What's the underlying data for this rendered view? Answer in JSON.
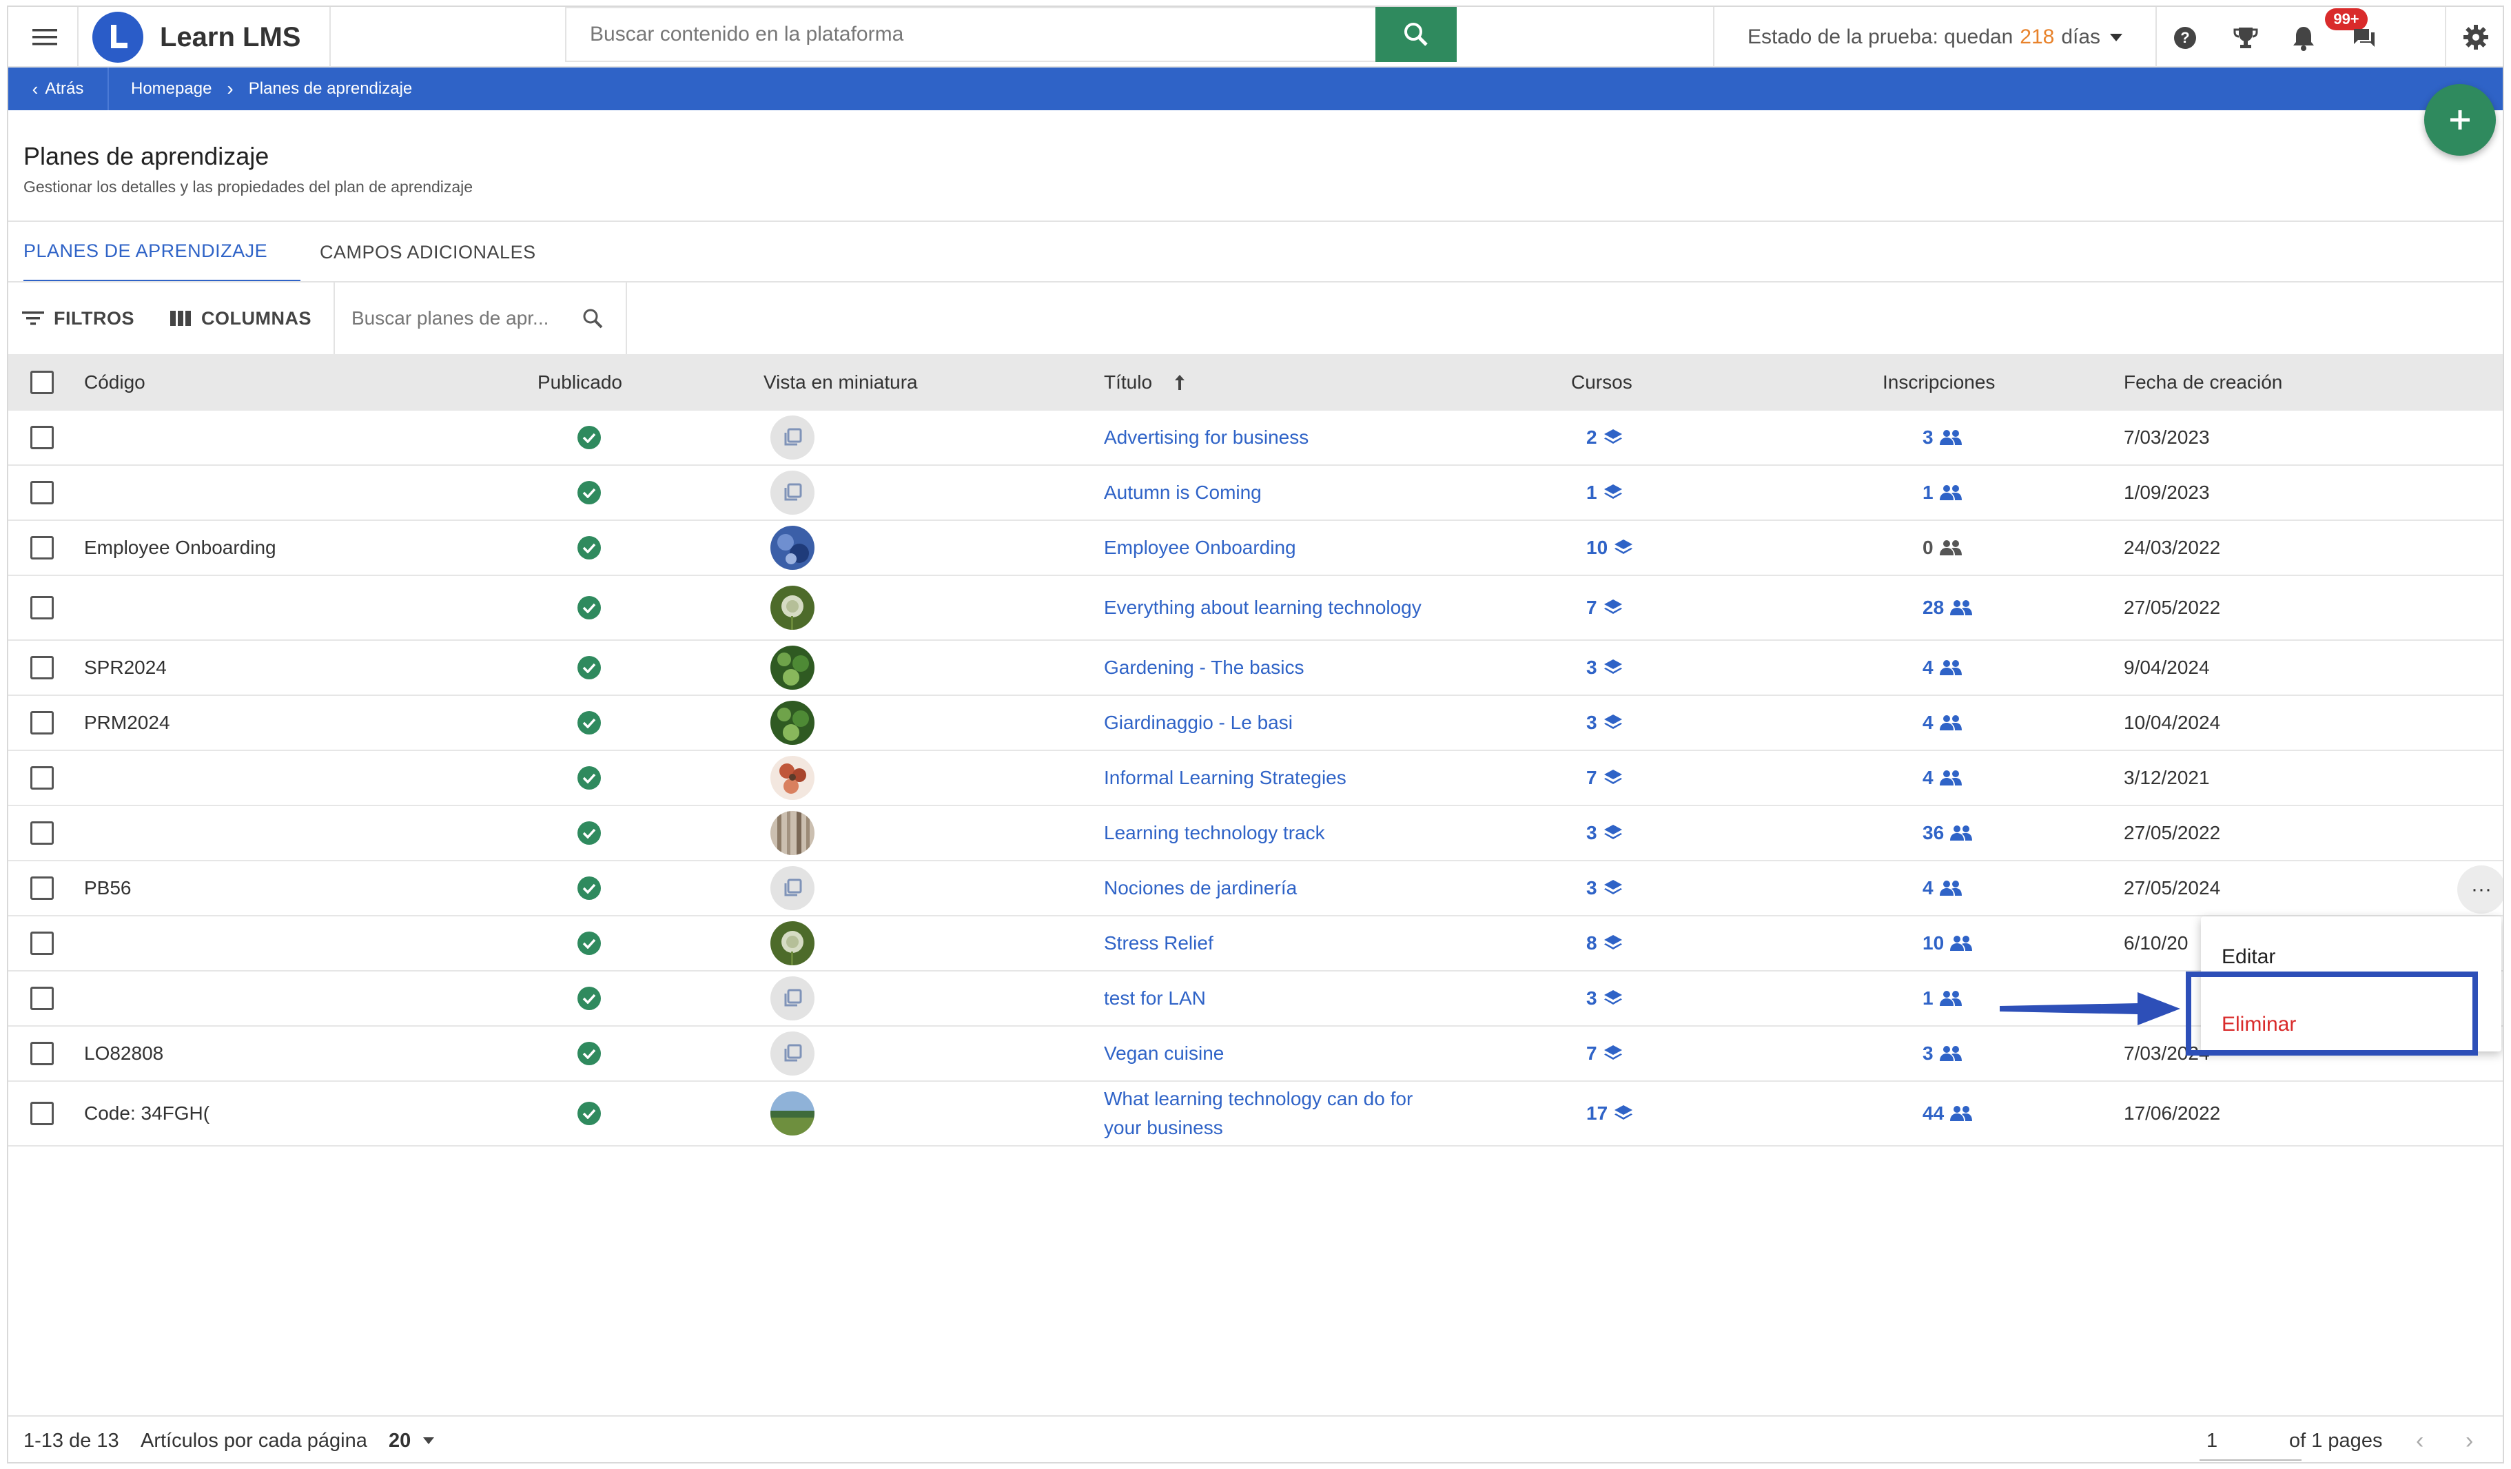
{
  "app": {
    "name": "Learn LMS",
    "accent": "#2f63c7",
    "primary_green": "#2f8a5e"
  },
  "topbar": {
    "search_placeholder": "Buscar contenido en la plataforma",
    "trial_prefix": "Estado de la prueba: quedan",
    "trial_days": "218",
    "trial_suffix": "días",
    "notifications_badge": "99+",
    "icons": [
      "menu-icon",
      "search-icon",
      "help-icon",
      "trophy-icon",
      "bell-icon",
      "chat-icon",
      "gear-icon"
    ]
  },
  "breadcrumb": {
    "back": "Atrás",
    "items": [
      "Homepage",
      "Planes de aprendizaje"
    ]
  },
  "header": {
    "title": "Planes de aprendizaje",
    "subtitle": "Gestionar los detalles y las propiedades del plan de aprendizaje"
  },
  "tabs": [
    {
      "label": "PLANES DE APRENDIZAJE",
      "active": true
    },
    {
      "label": "CAMPOS ADICIONALES",
      "active": false
    }
  ],
  "toolbar": {
    "filters": "FILTROS",
    "columns": "COLUMNAS",
    "search_placeholder": "Buscar planes de apr..."
  },
  "table": {
    "columns": [
      "Código",
      "Publicado",
      "Vista en miniatura",
      "Título",
      "Cursos",
      "Inscripciones",
      "Fecha de creación"
    ],
    "sorted_by": "Título",
    "sort_direction": "ascending",
    "rows": [
      {
        "code": "",
        "published": true,
        "thumb": "placeholder",
        "title": "Advertising for business",
        "courses": "2",
        "enrollments": "3",
        "date": "7/03/2023"
      },
      {
        "code": "",
        "published": true,
        "thumb": "placeholder",
        "title": "Autumn is Coming",
        "courses": "1",
        "enrollments": "1",
        "date": "1/09/2023"
      },
      {
        "code": "Employee Onboarding",
        "published": true,
        "thumb": "blue-photo",
        "title": "Employee Onboarding",
        "courses": "10",
        "enrollments": "0",
        "date": "24/03/2022"
      },
      {
        "code": "",
        "published": true,
        "thumb": "dandelion-photo",
        "title": "Everything about learning technology",
        "courses": "7",
        "enrollments": "28",
        "date": "27/05/2022"
      },
      {
        "code": "SPR2024",
        "published": true,
        "thumb": "garden-photo",
        "title": "Gardening - The basics",
        "courses": "3",
        "enrollments": "4",
        "date": "9/04/2024"
      },
      {
        "code": "PRM2024",
        "published": true,
        "thumb": "garden-photo",
        "title": "Giardinaggio - Le basi",
        "courses": "3",
        "enrollments": "4",
        "date": "10/04/2024"
      },
      {
        "code": "",
        "published": true,
        "thumb": "flower-photo",
        "title": "Informal Learning Strategies",
        "courses": "7",
        "enrollments": "4",
        "date": "3/12/2021"
      },
      {
        "code": "",
        "published": true,
        "thumb": "wood-photo",
        "title": "Learning technology track",
        "courses": "3",
        "enrollments": "36",
        "date": "27/05/2022"
      },
      {
        "code": "PB56",
        "published": true,
        "thumb": "placeholder",
        "title": "Nociones de jardinería",
        "courses": "3",
        "enrollments": "4",
        "date": "27/05/2024"
      },
      {
        "code": "",
        "published": true,
        "thumb": "dandelion-photo",
        "title": "Stress Relief",
        "courses": "8",
        "enrollments": "10",
        "date": "6/10/20"
      },
      {
        "code": "",
        "published": true,
        "thumb": "placeholder",
        "title": "test for LAN",
        "courses": "3",
        "enrollments": "1",
        "date": ""
      },
      {
        "code": "LO82808",
        "published": true,
        "thumb": "placeholder",
        "title": "Vegan cuisine",
        "courses": "7",
        "enrollments": "3",
        "date": "7/03/2024"
      },
      {
        "code": "Code: 34FGH(",
        "published": true,
        "thumb": "field-photo",
        "title": "What learning technology can do for your business",
        "courses": "17",
        "enrollments": "44",
        "date": "17/06/2022"
      }
    ]
  },
  "context_menu": {
    "edit": "Editar",
    "delete": "Eliminar"
  },
  "pagination": {
    "range": "1-13 de 13",
    "per_page_label": "Artículos por cada página",
    "per_page": "20",
    "page": "1",
    "of_pages": "of 1 pages"
  }
}
